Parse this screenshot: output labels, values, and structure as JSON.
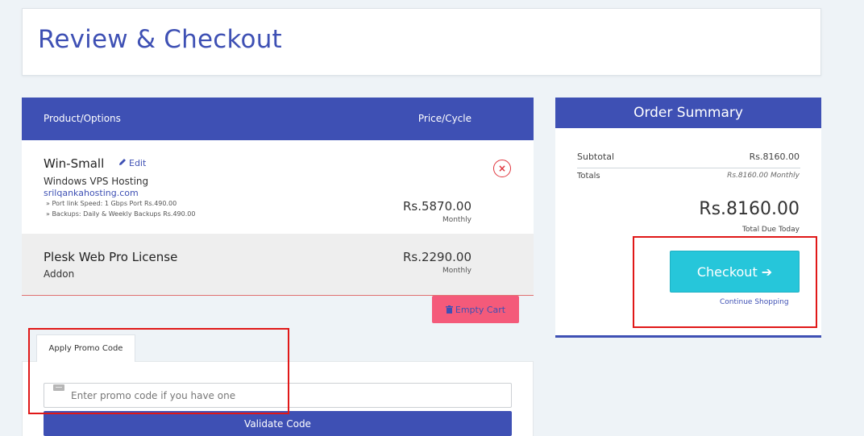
{
  "page": {
    "title": "Review & Checkout"
  },
  "cart": {
    "col_product": "Product/Options",
    "col_price": "Price/Cycle",
    "items": [
      {
        "name": "Win-Small",
        "edit_label": "Edit",
        "group": "Windows VPS Hosting",
        "domain": "srilqankahosting.com",
        "options": [
          "» Port link Speed: 1 Gbps Port Rs.490.00",
          "» Backups: Daily & Weekly Backups Rs.490.00"
        ],
        "price": "Rs.5870.00",
        "cycle": "Monthly",
        "remove_icon": "×"
      },
      {
        "name": "Plesk Web Pro License",
        "group": "Addon",
        "price": "Rs.2290.00",
        "cycle": "Monthly"
      }
    ],
    "empty_cart_label": "Empty Cart"
  },
  "promo": {
    "tab_label": "Apply Promo Code",
    "placeholder": "Enter promo code if you have one",
    "validate_label": "Validate Code"
  },
  "summary": {
    "title": "Order Summary",
    "subtotal_label": "Subtotal",
    "subtotal_value": "Rs.8160.00",
    "totals_label": "Totals",
    "totals_value": "Rs.8160.00 Monthly",
    "total_due": "Rs.8160.00",
    "total_due_label": "Total Due Today",
    "checkout_label": "Checkout",
    "checkout_arrow": "➔",
    "continue_label": "Continue Shopping"
  },
  "colors": {
    "primary": "#3e50b4",
    "checkout": "#26c6da",
    "empty_cart": "#f45a7a",
    "annotation": "#e01818"
  },
  "icons": {
    "edit": "pencil-icon",
    "remove": "remove-circle-icon",
    "empty_cart": "trash-icon",
    "promo": "ticket-icon",
    "checkout": "arrow-right-icon"
  }
}
